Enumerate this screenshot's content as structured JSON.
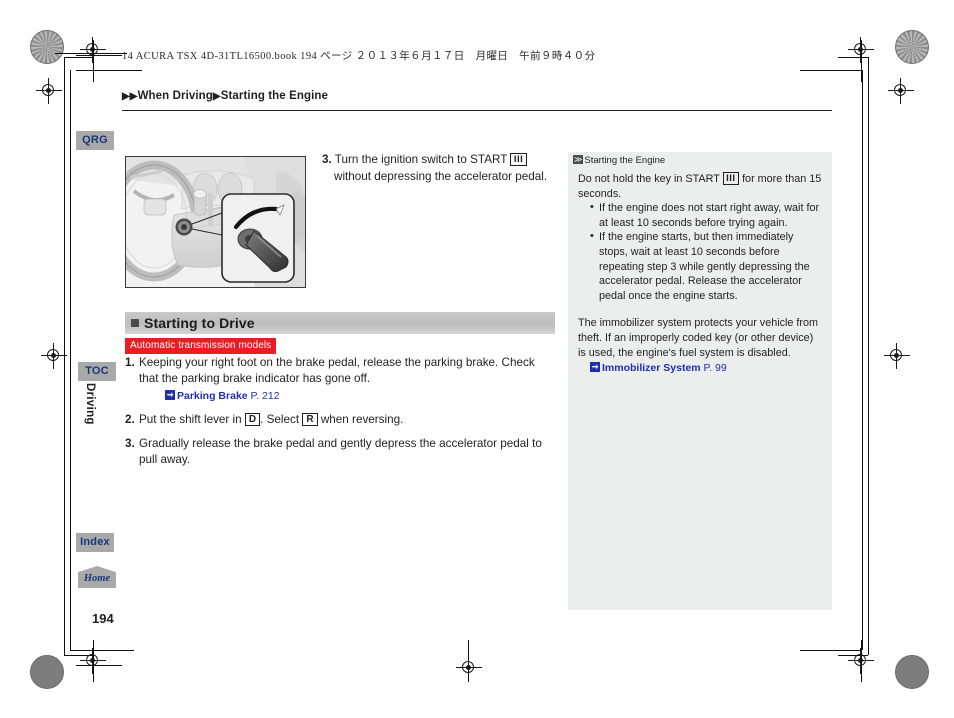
{
  "print_header": {
    "book_line": "14 ACURA TSX 4D-31TL16500.book   194 ページ   ２０１３年６月１７日　月曜日　午前９時４０分"
  },
  "breadcrumb": {
    "marker": "▶▶",
    "parent": "When Driving",
    "separator": "▶",
    "current": "Starting the Engine"
  },
  "side_nav": {
    "qrg": "QRG",
    "toc": "TOC",
    "chapter": "Driving",
    "index": "Index",
    "home": "Home"
  },
  "figure": {
    "caption": "ignition-switch-illustration",
    "alt": "Steering column ignition switch with callout of key turned to START"
  },
  "top_step": {
    "number": "3.",
    "text_before": "Turn the ignition switch to START",
    "glyph": "III",
    "text_after": "without depressing the accelerator pedal."
  },
  "section": {
    "title": "Starting to Drive",
    "badge": "Automatic transmission models"
  },
  "steps": [
    {
      "number": "1.",
      "text": "Keeping your right foot on the brake pedal, release the parking brake. Check that the parking brake indicator has gone off.",
      "xref": {
        "name": "Parking Brake",
        "page": "P. 212"
      }
    },
    {
      "number": "2.",
      "text_a": "Put the shift lever in",
      "gear_a": "D",
      "text_b": ". Select",
      "gear_b": "R",
      "text_c": "when reversing."
    },
    {
      "number": "3.",
      "text": "Gradually release the brake pedal and gently depress the accelerator pedal to pull away."
    }
  ],
  "info_panel": {
    "heading": "Starting the Engine",
    "heading_icon": "≫",
    "intro_before": "Do not hold the key in START",
    "intro_glyph": "III",
    "intro_after": "for more than 15 seconds.",
    "bullets": [
      "If the engine does not start right away, wait for at least 10 seconds before trying again.",
      "If the engine starts, but then immediately stops, wait at least 10 seconds before repeating step 3 while gently depressing the accelerator pedal. Release the accelerator pedal once the engine starts."
    ],
    "paragraph": "The immobilizer system protects your vehicle from theft. If an improperly coded key (or other device) is used, the engine's fuel system is disabled.",
    "xref": {
      "name": "Immobilizer System",
      "page": "P. 99"
    }
  },
  "page_number": "194",
  "colors": {
    "badge_red": "#ed1c24",
    "xref_blue": "#1f2fb0",
    "tab_gray": "#a9a9a9",
    "tab_text_blue": "#17377a",
    "panel_gray": "#eceded",
    "section_bar_gray": "#bdbdbd"
  }
}
